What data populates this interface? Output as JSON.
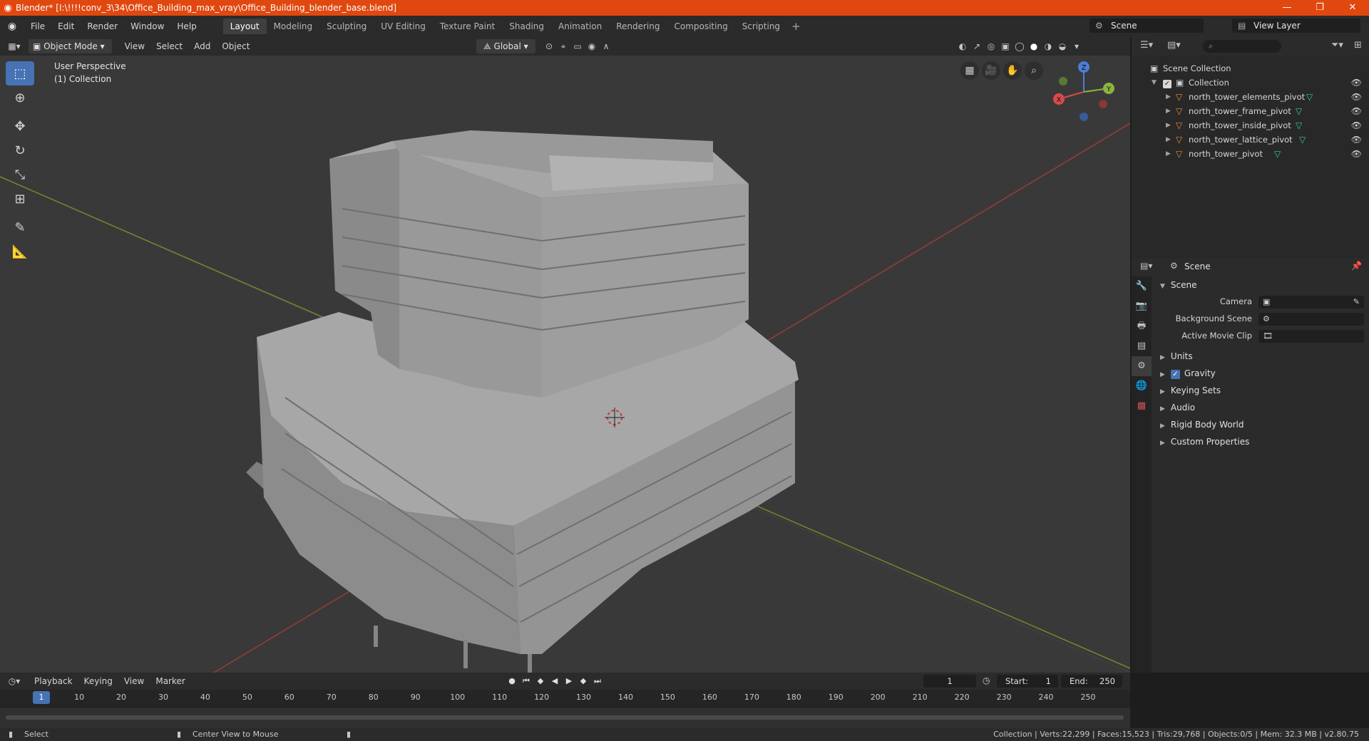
{
  "window": {
    "title": "Blender* [I:\\!!!!conv_3\\34\\Office_Building_max_vray\\Office_Building_blender_base.blend]",
    "minimize": "—",
    "restore": "❐",
    "close": "✕"
  },
  "menu": [
    "File",
    "Edit",
    "Render",
    "Window",
    "Help"
  ],
  "workspaces": [
    "Layout",
    "Modeling",
    "Sculpting",
    "UV Editing",
    "Texture Paint",
    "Shading",
    "Animation",
    "Rendering",
    "Compositing",
    "Scripting"
  ],
  "add_workspace": "+",
  "scene_selector": "Scene",
  "view_layer": "View Layer",
  "viewport": {
    "mode": "Object Mode",
    "menu": [
      "View",
      "Select",
      "Add",
      "Object"
    ],
    "orientation": "Global",
    "overlay_title": "User Perspective",
    "overlay_collection": "(1) Collection",
    "gizmo_axes": {
      "z": "Z",
      "y": "Y",
      "x": "X"
    },
    "colors": {
      "x_axis": "#9b3a3a",
      "y_axis": "#6e8a2c",
      "bg": "#393939"
    }
  },
  "outliner": {
    "search_placeholder": "",
    "root": "Scene Collection",
    "collection": "Collection",
    "items": [
      "north_tower_elements_pivot",
      "north_tower_frame_pivot",
      "north_tower_inside_pivot",
      "north_tower_lattice_pivot",
      "north_tower_pivot"
    ]
  },
  "properties": {
    "context": "Scene",
    "panel_scene": "Scene",
    "rows": [
      {
        "label": "Camera"
      },
      {
        "label": "Background Scene"
      },
      {
        "label": "Active Movie Clip"
      }
    ],
    "subpanels": [
      "Units",
      "Gravity",
      "Keying Sets",
      "Audio",
      "Rigid Body World",
      "Custom Properties"
    ]
  },
  "timeline": {
    "menu": [
      "Playback",
      "Keying",
      "View",
      "Marker"
    ],
    "current_frame": "1",
    "start_label": "Start:",
    "start": "1",
    "end_label": "End:",
    "end": "250",
    "ticks": [
      "10",
      "20",
      "30",
      "40",
      "50",
      "60",
      "70",
      "80",
      "90",
      "100",
      "110",
      "120",
      "130",
      "140",
      "150",
      "160",
      "170",
      "180",
      "190",
      "200",
      "210",
      "220",
      "230",
      "240",
      "250"
    ],
    "cursor": "1"
  },
  "status": {
    "select": "Select",
    "center_view": "Center View to Mouse",
    "stats": "Collection | Verts:22,299 | Faces:15,523 | Tris:29,768 | Objects:0/5 | Mem: 32.3 MB | v2.80.75"
  },
  "accent": "#4772b3",
  "title_bar_color": "#e0480f"
}
